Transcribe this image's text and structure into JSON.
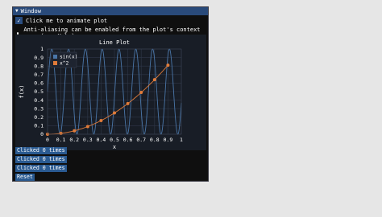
{
  "window": {
    "title": "Window",
    "collapse_glyph": "▼"
  },
  "checkbox": {
    "label": "Click me to animate plot",
    "checked": true,
    "glyph": "✓"
  },
  "bullet_text": "Anti-aliasing can be enabled from the plot's context menu (see Help).",
  "chart_data": {
    "type": "line",
    "title": "Line Plot",
    "xlabel": "x",
    "ylabel": "f(x)",
    "xlim": [
      0,
      1
    ],
    "ylim": [
      0,
      1
    ],
    "x_ticks": [
      "0",
      "0.1",
      "0.2",
      "0.3",
      "0.4",
      "0.5",
      "0.6",
      "0.7",
      "0.8",
      "0.9",
      "1"
    ],
    "y_ticks": [
      "0",
      "0.1",
      "0.2",
      "0.3",
      "0.4",
      "0.5",
      "0.6",
      "0.7",
      "0.8",
      "0.9",
      "1"
    ],
    "grid": true,
    "legend_position": "top-left",
    "series": [
      {
        "name": "sin(x)",
        "color": "#4a76a8",
        "marker": "none",
        "sine_frequency": 50,
        "sine_amplitude": 0.5,
        "sine_offset": 0.5,
        "sample_count": 1001
      },
      {
        "name": "x^2",
        "color": "#e07b39",
        "marker": "circle",
        "x": [
          0.0,
          0.1,
          0.2,
          0.3,
          0.4,
          0.5,
          0.6,
          0.7,
          0.8,
          0.9
        ],
        "y": [
          0.0,
          0.01,
          0.04,
          0.09,
          0.16,
          0.25,
          0.36,
          0.49,
          0.64,
          0.81
        ]
      }
    ]
  },
  "buttons": [
    {
      "label": "Clicked 0 times"
    },
    {
      "label": "Clicked 0 times"
    },
    {
      "label": "Clicked 0 times"
    }
  ],
  "reset_label": "Reset",
  "colors": {
    "titlebar": "#294a7a",
    "button": "#2a5a91",
    "plot_bg": "#181d26",
    "window_bg": "#0f0f0f"
  }
}
